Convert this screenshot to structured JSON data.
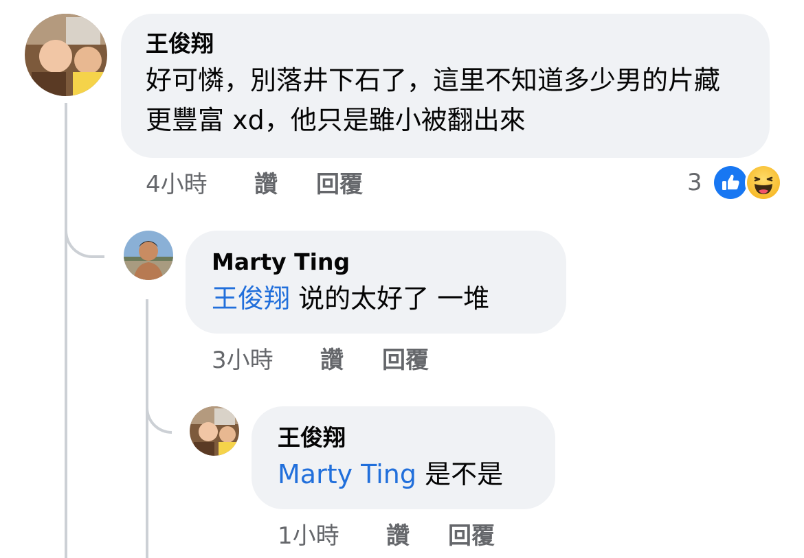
{
  "comments": [
    {
      "author": "王俊翔",
      "text": "好可憐，別落井下石了，這里不知道多少男的片藏更豐富 xd，他只是雖小被翻出來",
      "time": "4小時",
      "like_label": "讚",
      "reply_label": "回覆",
      "reaction_count": "3",
      "reactions": [
        "like-icon",
        "haha-icon"
      ]
    },
    {
      "author": "Marty Ting",
      "mention": "王俊翔",
      "text": "说的太好了 一堆",
      "time": "3小時",
      "like_label": "讚",
      "reply_label": "回覆"
    },
    {
      "author": "王俊翔",
      "mention": "Marty Ting",
      "text": "是不是",
      "time": "1小時",
      "like_label": "讚",
      "reply_label": "回覆"
    }
  ],
  "colors": {
    "bubble": "#f0f2f5",
    "mention": "#216fdb",
    "meta": "#65676b",
    "like_blue": "#1877f2",
    "haha_yellow": "#f7b928"
  }
}
